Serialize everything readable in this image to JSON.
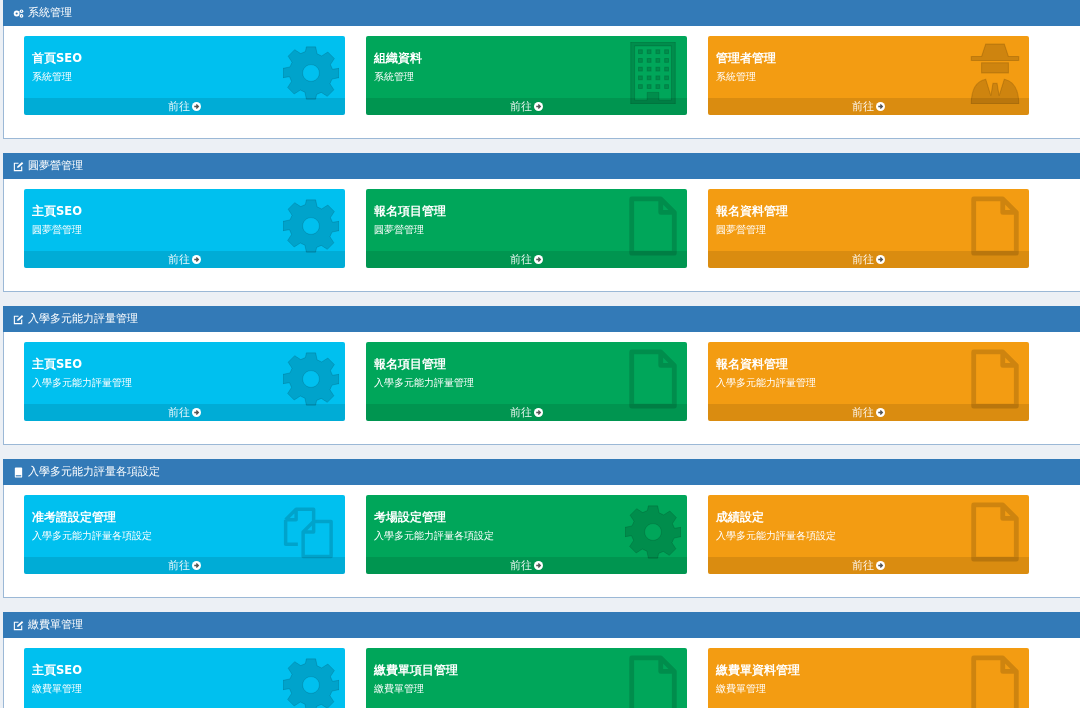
{
  "panels": [
    {
      "title": "系統管理",
      "kind": "cogs",
      "cards": [
        {
          "title": "首頁SEO",
          "subtitle": "系統管理",
          "footer": "前往",
          "color": "#00c0ef",
          "kind": "gear"
        },
        {
          "title": "組織資料",
          "subtitle": "系統管理",
          "footer": "前往",
          "color": "#00a65a",
          "kind": "building"
        },
        {
          "title": "管理者管理",
          "subtitle": "系統管理",
          "footer": "前往",
          "color": "#f39c12",
          "kind": "spy"
        }
      ]
    },
    {
      "title": "圓夢營管理",
      "kind": "edit",
      "cards": [
        {
          "title": "主頁SEO",
          "subtitle": "圓夢營管理",
          "footer": "前往",
          "color": "#00c0ef",
          "kind": "gear"
        },
        {
          "title": "報名項目管理",
          "subtitle": "圓夢營管理",
          "footer": "前往",
          "color": "#00a65a",
          "kind": "file"
        },
        {
          "title": "報名資料管理",
          "subtitle": "圓夢營管理",
          "footer": "前往",
          "color": "#f39c12",
          "kind": "file"
        }
      ]
    },
    {
      "title": "入學多元能力評量管理",
      "kind": "edit",
      "cards": [
        {
          "title": "主頁SEO",
          "subtitle": "入學多元能力評量管理",
          "footer": "前往",
          "color": "#00c0ef",
          "kind": "gear"
        },
        {
          "title": "報名項目管理",
          "subtitle": "入學多元能力評量管理",
          "footer": "前往",
          "color": "#00a65a",
          "kind": "file"
        },
        {
          "title": "報名資料管理",
          "subtitle": "入學多元能力評量管理",
          "footer": "前往",
          "color": "#f39c12",
          "kind": "file"
        }
      ]
    },
    {
      "title": "入學多元能力評量各項設定",
      "kind": "book",
      "cards": [
        {
          "title": "准考證設定管理",
          "subtitle": "入學多元能力評量各項設定",
          "footer": "前往",
          "color": "#00c0ef",
          "kind": "files"
        },
        {
          "title": "考場設定管理",
          "subtitle": "入學多元能力評量各項設定",
          "footer": "前往",
          "color": "#00a65a",
          "kind": "gear"
        },
        {
          "title": "成績設定",
          "subtitle": "入學多元能力評量各項設定",
          "footer": "前往",
          "color": "#f39c12",
          "kind": "file"
        }
      ]
    },
    {
      "title": "繳費單管理",
      "kind": "edit",
      "cards": [
        {
          "title": "主頁SEO",
          "subtitle": "繳費單管理",
          "color": "#00c0ef",
          "kind": "gear"
        },
        {
          "title": "繳費單項目管理",
          "subtitle": "繳費單管理",
          "color": "#00a65a",
          "kind": "file"
        },
        {
          "title": "繳費單資料管理",
          "subtitle": "繳費單管理",
          "color": "#f39c12",
          "kind": "file"
        }
      ]
    }
  ]
}
